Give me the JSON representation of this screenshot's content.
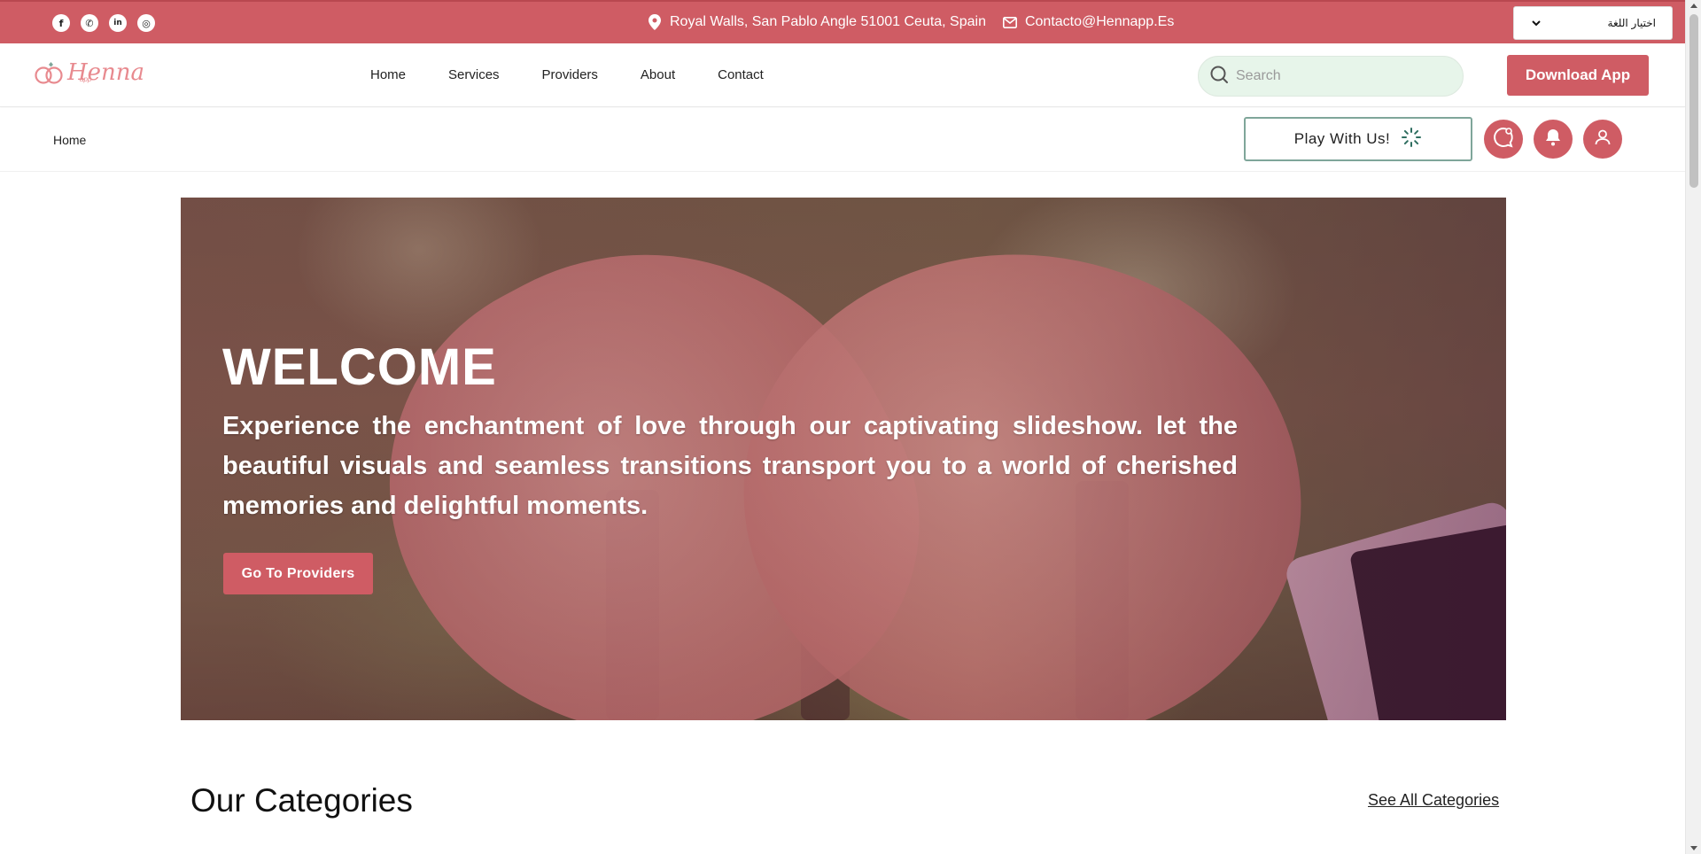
{
  "topbar": {
    "socials": [
      {
        "icon": "facebook-icon",
        "glyph": "f"
      },
      {
        "icon": "whatsapp-icon",
        "glyph": "✆"
      },
      {
        "icon": "linkedin-icon",
        "glyph": "in"
      },
      {
        "icon": "instagram-icon",
        "glyph": "◎"
      }
    ],
    "address": "Royal Walls, San Pablo Angle 51001 Ceuta, Spain",
    "email": "Contacto@Hennapp.Es",
    "language_label": "اختيار اللغة"
  },
  "nav": {
    "logo_text": "Henna",
    "logo_sub": "app",
    "links": [
      "Home",
      "Services",
      "Providers",
      "About",
      "Contact"
    ],
    "search_placeholder": "Search",
    "download_label": "Download App"
  },
  "subbar": {
    "breadcrumb": "Home",
    "play_label": "Play With Us!"
  },
  "hero": {
    "title": "WELCOME",
    "description": "Experience the enchantment of love through our captivating slideshow. let the beautiful visuals and seamless transitions transport you to a world of cherished memories and delightful moments.",
    "button_label": "Go To Providers"
  },
  "categories": {
    "title": "Our Categories",
    "see_all_label": "See All Categories"
  },
  "colors": {
    "brand": "#cf5c64",
    "search_bg": "#e7f5ea",
    "play_border": "#7fa69a"
  }
}
